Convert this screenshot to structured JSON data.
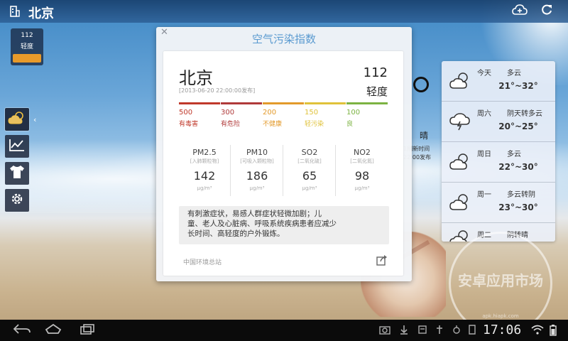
{
  "header": {
    "city": "北京",
    "app_icon": "building-icon",
    "add_cloud_icon": "cloud-add-icon",
    "refresh_icon": "refresh-icon"
  },
  "aqi_badge": {
    "value": "112",
    "level": "轻度"
  },
  "nav": {
    "items": [
      "weather-icon",
      "chart-line-icon",
      "shirt-icon",
      "gear-icon"
    ],
    "arrow": "‹"
  },
  "behind": {
    "condition": "晴",
    "faint_line1": "1刷新时间",
    "faint_line2": "22:00发布"
  },
  "dialog": {
    "title": "空气污染指数",
    "close": "✕",
    "city": "北京",
    "publish_time": "[2013-06-20 22:00:00发布]",
    "aqi": "112",
    "level": "轻度",
    "scale": [
      {
        "value": "500",
        "label": "有毒害",
        "color": "#c0392b"
      },
      {
        "value": "300",
        "label": "有危险",
        "color": "#b03a3a"
      },
      {
        "value": "200",
        "label": "不健康",
        "color": "#e39a2b"
      },
      {
        "value": "150",
        "label": "轻污染",
        "color": "#e0c23a"
      },
      {
        "value": "100",
        "label": "良",
        "color": "#7cb342"
      }
    ],
    "metrics": [
      {
        "name": "PM2.5",
        "desc": "[入肺颗粒物]",
        "value": "142",
        "unit": "μg/m³"
      },
      {
        "name": "PM10",
        "desc": "[可吸入颗粒物]",
        "value": "186",
        "unit": "μg/m³"
      },
      {
        "name": "SO2",
        "desc": "[二氧化硫]",
        "value": "65",
        "unit": "μg/m³"
      },
      {
        "name": "NO2",
        "desc": "[二氧化氮]",
        "value": "98",
        "unit": "μg/m³"
      }
    ],
    "advice_lines": [
      "有刺激症状，易感人群症状轻微加剧；儿",
      "童、老人及心脏病、呼吸系统疾病患者应减少",
      "长时间、高轻度的户外锻炼。"
    ],
    "source": "中国环境总站",
    "share_icon": "share-icon"
  },
  "forecast": [
    {
      "day": "今天",
      "condition": "多云",
      "temp": "21°~32°",
      "icon": "partly-cloudy-icon"
    },
    {
      "day": "周六",
      "condition": "阴天转多云",
      "temp": "20°~25°",
      "icon": "thunderstorm-icon"
    },
    {
      "day": "周日",
      "condition": "多云",
      "temp": "22°~30°",
      "icon": "partly-cloudy-icon"
    },
    {
      "day": "周一",
      "condition": "多云转阴",
      "temp": "23°~30°",
      "icon": "partly-cloudy-icon"
    },
    {
      "day": "周二",
      "condition": "阴转晴",
      "temp": "",
      "icon": "partly-cloudy-icon"
    }
  ],
  "watermark": {
    "text": "安卓应用市场",
    "sub": "apk.hiapk.com"
  },
  "system": {
    "time": "17:06"
  }
}
